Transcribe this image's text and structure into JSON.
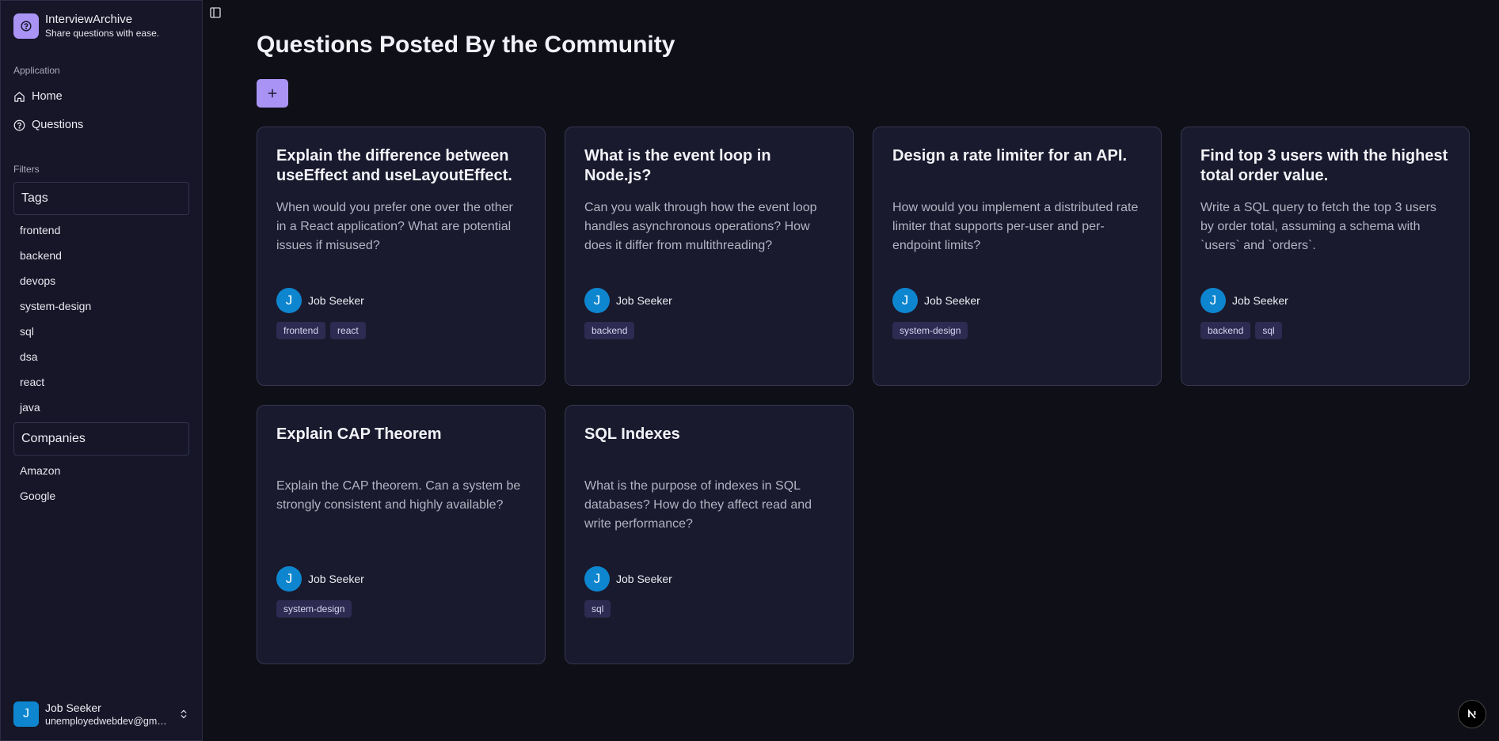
{
  "brand": {
    "name": "InterviewArchive",
    "tagline": "Share questions with ease."
  },
  "sidebar": {
    "application_label": "Application",
    "nav": [
      {
        "label": "Home",
        "icon": "home-icon"
      },
      {
        "label": "Questions",
        "icon": "help-circle-icon"
      }
    ],
    "filters_label": "Filters",
    "tags_title": "Tags",
    "tags": [
      "frontend",
      "backend",
      "devops",
      "system-design",
      "sql",
      "dsa",
      "react",
      "java"
    ],
    "companies_title": "Companies",
    "companies": [
      "Amazon",
      "Google"
    ]
  },
  "user": {
    "initial": "J",
    "name": "Job Seeker",
    "email": "unemployedwebdev@gmail.com"
  },
  "main": {
    "title": "Questions Posted By the Community"
  },
  "cards": [
    {
      "title": "Explain the difference between useEffect and useLayoutEffect.",
      "body": "When would you prefer one over the other in a React application? What are potential issues if misused?",
      "author": "Job Seeker",
      "initial": "J",
      "tags": [
        "frontend",
        "react"
      ]
    },
    {
      "title": "What is the event loop in Node.js?",
      "body": "Can you walk through how the event loop handles asynchronous operations? How does it differ from multithreading?",
      "author": "Job Seeker",
      "initial": "J",
      "tags": [
        "backend"
      ]
    },
    {
      "title": "Design a rate limiter for an API.",
      "body": "How would you implement a distributed rate limiter that supports per-user and per-endpoint limits?",
      "author": "Job Seeker",
      "initial": "J",
      "tags": [
        "system-design"
      ]
    },
    {
      "title": "Find top 3 users with the highest total order value.",
      "body": "Write a SQL query to fetch the top 3 users by order total, assuming a schema with `users` and `orders`.",
      "author": "Job Seeker",
      "initial": "J",
      "tags": [
        "backend",
        "sql"
      ]
    },
    {
      "title": "Explain CAP Theorem",
      "body": "Explain the CAP theorem. Can a system be strongly consistent and highly available?",
      "author": "Job Seeker",
      "initial": "J",
      "tags": [
        "system-design"
      ]
    },
    {
      "title": "SQL Indexes",
      "body": "What is the purpose of indexes in SQL databases? How do they affect read and write performance?",
      "author": "Job Seeker",
      "initial": "J",
      "tags": [
        "sql"
      ]
    }
  ],
  "colors": {
    "accent": "#a994f5",
    "avatar": "#0e86cf",
    "chip": "#2e2b52"
  },
  "badge": "N"
}
